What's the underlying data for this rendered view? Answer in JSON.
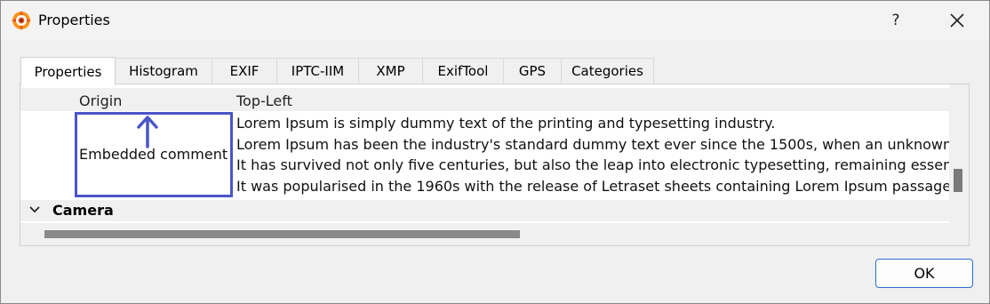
{
  "window": {
    "title": "Properties",
    "help_label": "?",
    "close_icon": "close-icon",
    "app_icon": "app-eye-icon"
  },
  "tabs": [
    {
      "label": "Properties",
      "active": true
    },
    {
      "label": "Histogram",
      "active": false
    },
    {
      "label": "EXIF",
      "active": false
    },
    {
      "label": "IPTC-IIM",
      "active": false
    },
    {
      "label": "XMP",
      "active": false
    },
    {
      "label": "ExifTool",
      "active": false
    },
    {
      "label": "GPS",
      "active": false
    },
    {
      "label": "Categories",
      "active": false
    }
  ],
  "properties": {
    "origin": {
      "label": "Origin",
      "value": "Top-Left"
    },
    "comment": {
      "label": "Embedded comment",
      "lines": [
        "Lorem Ipsum is simply dummy text of the printing and typesetting industry.",
        "Lorem Ipsum has been the industry's standard dummy text ever since the 1500s, when an unknown p",
        "It has survived not only five centuries, but also the leap into electronic typesetting, remaining essenti",
        "It was popularised in the 1960s with the release of Letraset sheets containing Lorem Ipsum passages,"
      ]
    },
    "camera_section": {
      "label": "Camera",
      "expanded": true
    }
  },
  "annotation": {
    "color": "#4a55c8",
    "icon": "up-arrow-icon"
  },
  "buttons": {
    "ok_label": "OK"
  },
  "colors": {
    "accent": "#2c6ecb",
    "highlight": "#4a55c8"
  }
}
